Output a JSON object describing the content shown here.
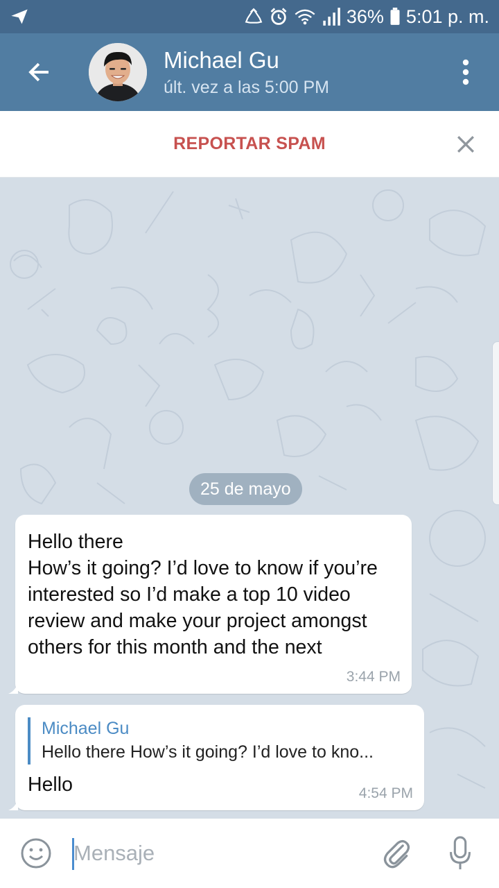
{
  "status_bar": {
    "battery_percent": "36%",
    "time": "5:01 p. m.",
    "icons": [
      "telegram-send-icon",
      "recycle-icon",
      "alarm-icon",
      "wifi-icon",
      "signal-icon",
      "battery-icon"
    ]
  },
  "header": {
    "title": "Michael Gu",
    "subtitle": "últ. vez a las 5:00 PM"
  },
  "spam_bar": {
    "label": "REPORTAR SPAM"
  },
  "chat": {
    "date_label": "25 de mayo",
    "messages": [
      {
        "text": "Hello there\nHow’s it going? I’d love to know if you’re interested so I’d make a top 10 video review and make your project amongst others for this month and the next",
        "time": "3:44 PM"
      },
      {
        "reply_name": "Michael Gu",
        "reply_text": "Hello there  How’s it going? I’d love to kno...",
        "text": "Hello",
        "time": "4:54 PM"
      }
    ]
  },
  "input": {
    "placeholder": "Mensaje",
    "value": ""
  },
  "colors": {
    "status_bar": "#44698d",
    "header": "#517da2",
    "chat_background": "#d4dde6",
    "spam_text": "#c7514f",
    "reply_accent": "#4b8bc4"
  }
}
